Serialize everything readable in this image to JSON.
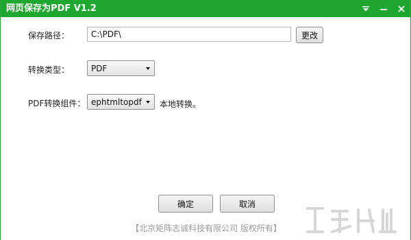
{
  "titlebar": {
    "title": "网页保存为PDF  V1.2",
    "buttons": [
      "dropdown-icon",
      "minimize-icon",
      "close-icon"
    ]
  },
  "form": {
    "save_path_label": "保存路径：",
    "save_path_value": "C:\\PDF\\",
    "change_button": "更改",
    "convert_type_label": "转换类型：",
    "convert_type_value": "PDF",
    "component_label": "PDF转换组件：",
    "component_value": "ephtmltopdf",
    "component_note": "本地转换。"
  },
  "actions": {
    "ok": "确定",
    "cancel": "取消"
  },
  "footer": {
    "copyright": "【北京矩阵志诚科技有限公司 版权所有】"
  },
  "colors": {
    "titlebar": "#1ea82f",
    "window_bg": "#ffffff"
  }
}
